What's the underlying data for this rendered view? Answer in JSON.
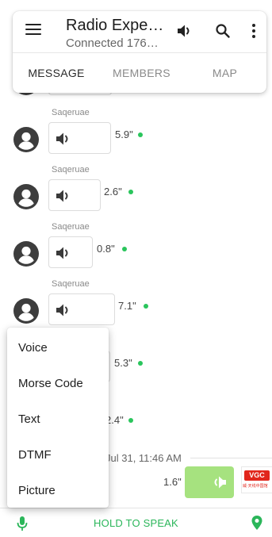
{
  "header": {
    "title": "Radio Expe…",
    "subtitle": "Connected 176…",
    "icons": [
      "menu-icon",
      "speaker-icon",
      "search-icon",
      "more-vertical-icon"
    ]
  },
  "tabs": [
    {
      "label": "MESSAGE",
      "active": true
    },
    {
      "label": "MEMBERS",
      "active": false
    },
    {
      "label": "MAP",
      "active": false
    }
  ],
  "messages": [
    {
      "sender": "Saqeruae",
      "duration": "5.9\""
    },
    {
      "sender": "Saqeruae",
      "duration": "2.6\""
    },
    {
      "sender": "Saqeruae",
      "duration": "0.8\""
    },
    {
      "sender": "Saqeruae",
      "duration": "7.1\""
    },
    {
      "sender": "",
      "duration": "5.3\""
    },
    {
      "sender": "",
      "duration": "2.4\""
    }
  ],
  "time_separator": "Jul 31, 11:46 AM",
  "own_message": {
    "duration": "1.6\""
  },
  "logo": {
    "main": "VGC",
    "sub": "威·天线中国馆"
  },
  "popup_menu": [
    "Voice",
    "Morse Code",
    "Text",
    "DTMF",
    "Picture"
  ],
  "bottom_bar": {
    "label": "HOLD TO SPEAK",
    "left_icon": "microphone-icon",
    "right_icon": "map-pin-icon"
  },
  "colors": {
    "accent_green": "#2bb65a",
    "own_bubble": "#a6e27f",
    "status_dot": "#2ac55c"
  }
}
